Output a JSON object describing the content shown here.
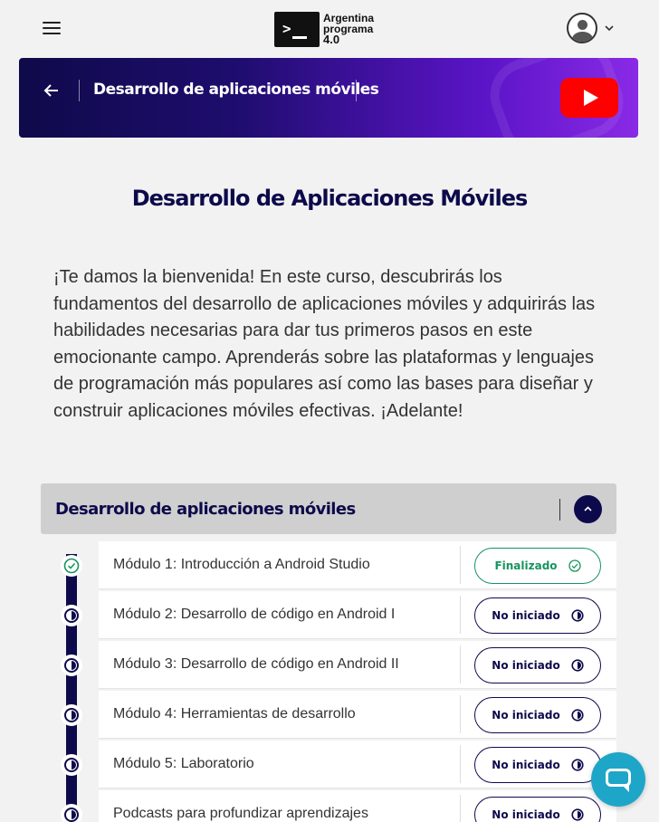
{
  "header": {
    "logo_line1": "Argentina",
    "logo_line2": "programa",
    "logo_line3": "4.0"
  },
  "banner": {
    "title": "Desarrollo de aplicaciones móviles"
  },
  "page": {
    "title": "Desarrollo de Aplicaciones Móviles",
    "intro": "¡Te damos la bienvenida! En este curso, descubrirás los fundamentos del desarrollo de aplicaciones móviles y adquirirás las habilidades necesarias para dar tus primeros pasos en este emocionante campo. Aprenderás sobre las plataformas y lenguajes de programación más populares así como las bases para diseñar y construir aplicaciones móviles efectivas. ¡Adelante!"
  },
  "accordion": {
    "title": "Desarrollo de aplicaciones móviles",
    "modules": [
      {
        "label": "Módulo 1: Introducción a Android Studio",
        "status": "Finalizado"
      },
      {
        "label": "Módulo 2: Desarrollo de código en Android I",
        "status": "No iniciado"
      },
      {
        "label": "Módulo 3: Desarrollo de código en Android II",
        "status": "No iniciado"
      },
      {
        "label": "Módulo 4: Herramientas de desarrollo",
        "status": "No iniciado"
      },
      {
        "label": "Módulo 5: Laboratorio",
        "status": "No iniciado"
      },
      {
        "label": "Podcasts para profundizar aprendizajes",
        "status": "No iniciado"
      }
    ]
  },
  "colors": {
    "navy": "#0d0a4b",
    "done_green": "#17935f",
    "chat_blue": "#1ea6c9",
    "youtube_red": "#ff0000"
  },
  "icons": {
    "menu": "hamburger-menu-icon",
    "back": "arrow-left-icon",
    "youtube": "youtube-play-icon",
    "collapse": "chevron-up-icon",
    "done": "check-circle-icon",
    "pending": "half-circle-icon",
    "chat": "chat-bubble-icon"
  }
}
